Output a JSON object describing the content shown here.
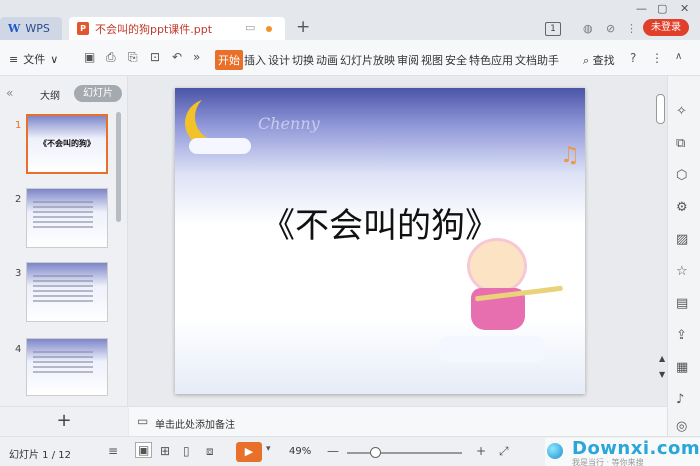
{
  "titlebar": {
    "wps_label": "WPS",
    "doc_name": "不会叫的狗ppt课件.ppt",
    "new_tab": "+",
    "page_badge": "1",
    "login_label": "未登录",
    "window": {
      "minimize": "—",
      "maximize": "▢",
      "close": "✕"
    }
  },
  "menubar": {
    "file_label": "文件",
    "tabs": [
      "开始",
      "插入",
      "设计",
      "切换",
      "动画",
      "幻灯片放映",
      "审阅",
      "视图",
      "安全",
      "特色应用",
      "文档助手"
    ],
    "active_tab": "开始",
    "find_label": "查找",
    "help": "?",
    "more": "⋮",
    "collapse": "∧"
  },
  "leftpanel": {
    "outline_label": "大纲",
    "slides_label": "幻灯片",
    "thumbnails": [
      {
        "num": "1",
        "title": "《不会叫的狗》"
      },
      {
        "num": "2",
        "title": ""
      },
      {
        "num": "3",
        "title": ""
      },
      {
        "num": "4",
        "title": ""
      }
    ],
    "add_label": "+"
  },
  "slide": {
    "cursive": "Chenny",
    "title": "《不会叫的狗》",
    "notes_note": "♫"
  },
  "notes": {
    "placeholder": "单击此处添加备注"
  },
  "statusbar": {
    "slide_count": "幻灯片 1 / 12",
    "zoom": "49%",
    "zoom_minus": "—",
    "zoom_plus": "+",
    "watermark_logo": "Downxi.com",
    "watermark_sub": "我是当行 · 等你来搜"
  },
  "colors": {
    "accent": "#e8702a",
    "login": "#e0402a",
    "wps_blue": "#2459c8"
  }
}
